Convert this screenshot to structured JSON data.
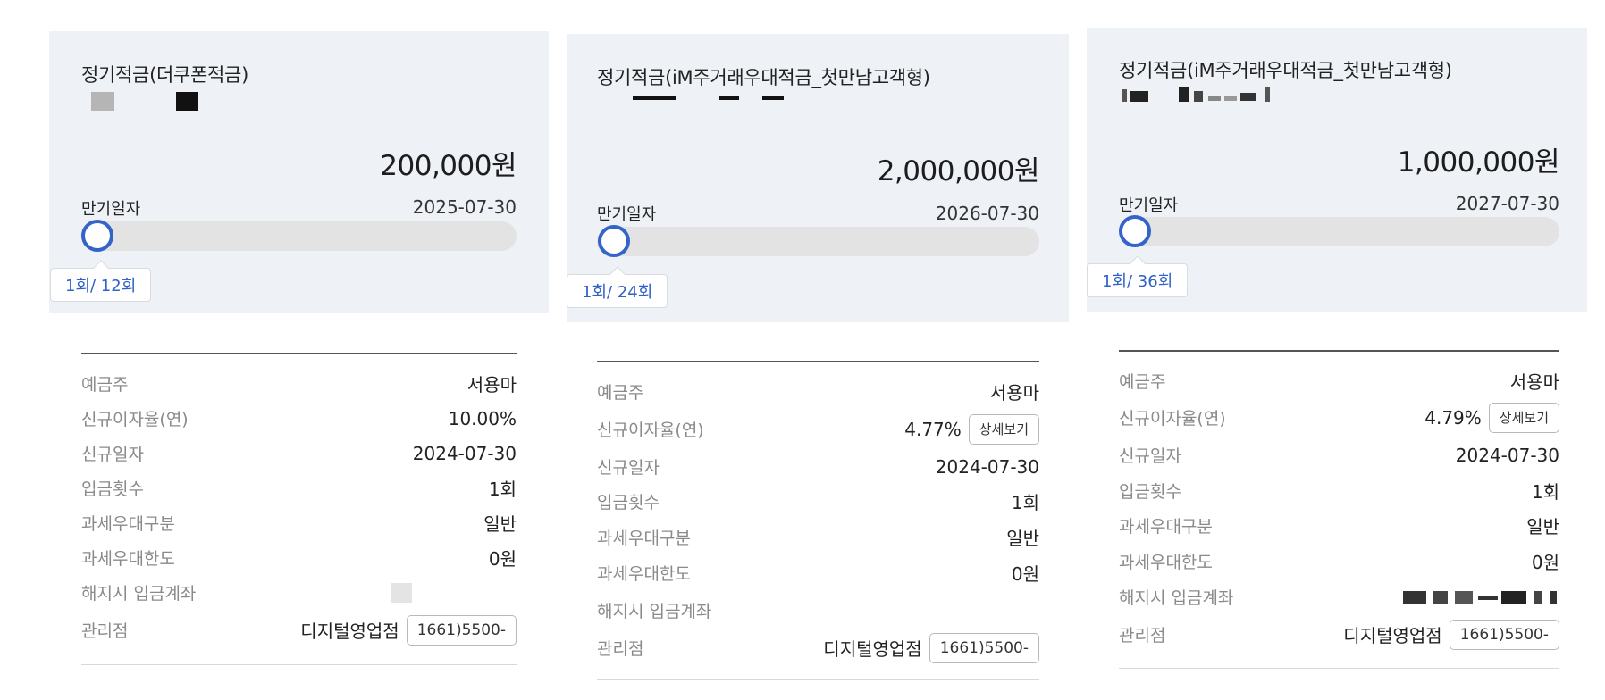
{
  "accounts": [
    {
      "product_name": "정기적금(더쿠폰적금)",
      "amount": "200,000원",
      "maturity_label": "만기일자",
      "maturity_date": "2025-07-30",
      "installment_progress": "1회/ 12회",
      "progress_fraction": 0.083,
      "details": [
        {
          "label": "예금주",
          "value": "서용마"
        },
        {
          "label": "신규이자율(연)",
          "value": "10.00%"
        },
        {
          "label": "신규일자",
          "value": "2024-07-30"
        },
        {
          "label": "입금횟수",
          "value": "1회"
        },
        {
          "label": "과세우대구분",
          "value": "일반"
        },
        {
          "label": "과세우대한도",
          "value": "0원"
        },
        {
          "label": "해지시 입금계좌",
          "value": ""
        },
        {
          "label": "관리점",
          "value": "디지털영업점",
          "button": "1661)5500-"
        }
      ]
    },
    {
      "product_name": "정기적금(iM주거래우대적금_첫만남고객형)",
      "amount": "2,000,000원",
      "maturity_label": "만기일자",
      "maturity_date": "2026-07-30",
      "installment_progress": "1회/ 24회",
      "progress_fraction": 0.042,
      "details": [
        {
          "label": "예금주",
          "value": "서용마"
        },
        {
          "label": "신규이자율(연)",
          "value": "4.77%",
          "button": "상세보기"
        },
        {
          "label": "신규일자",
          "value": "2024-07-30"
        },
        {
          "label": "입금횟수",
          "value": "1회"
        },
        {
          "label": "과세우대구분",
          "value": "일반"
        },
        {
          "label": "과세우대한도",
          "value": "0원"
        },
        {
          "label": "해지시 입금계좌",
          "value": ""
        },
        {
          "label": "관리점",
          "value": "디지털영업점",
          "button": "1661)5500-"
        }
      ]
    },
    {
      "product_name": "정기적금(iM주거래우대적금_첫만남고객형)",
      "amount": "1,000,000원",
      "maturity_label": "만기일자",
      "maturity_date": "2027-07-30",
      "installment_progress": "1회/ 36회",
      "progress_fraction": 0.028,
      "details": [
        {
          "label": "예금주",
          "value": "서용마"
        },
        {
          "label": "신규이자율(연)",
          "value": "4.79%",
          "button": "상세보기"
        },
        {
          "label": "신규일자",
          "value": "2024-07-30"
        },
        {
          "label": "입금횟수",
          "value": "1회"
        },
        {
          "label": "과세우대구분",
          "value": "일반"
        },
        {
          "label": "과세우대한도",
          "value": "0원"
        },
        {
          "label": "해지시 입금계좌",
          "value": ""
        },
        {
          "label": "관리점",
          "value": "디지털영업점",
          "button": "1661)5500-"
        }
      ]
    }
  ],
  "colors": {
    "card_bg": "#eef2f7",
    "accent": "#3463c9",
    "track": "#e3e3e3"
  }
}
